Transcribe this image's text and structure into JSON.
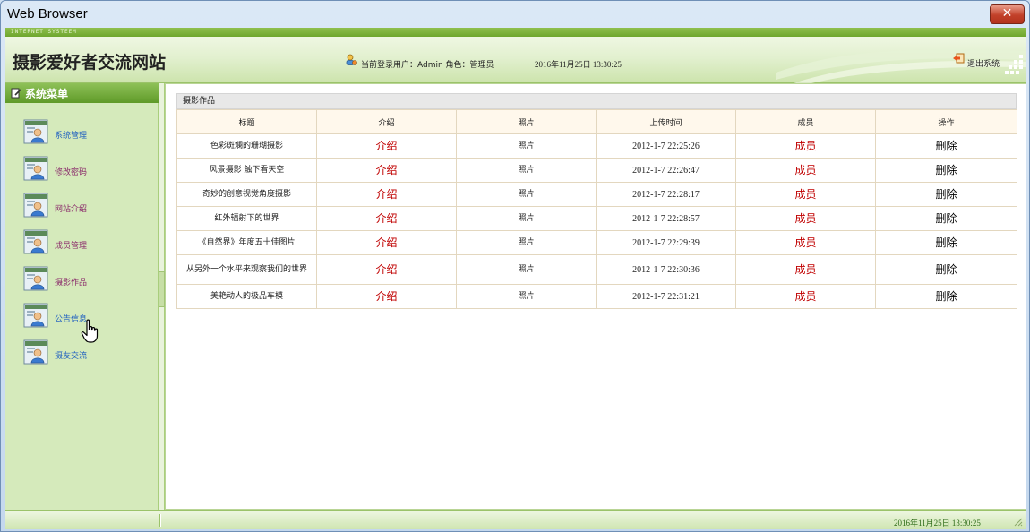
{
  "window": {
    "title": "Web Browser",
    "close_label": "✕"
  },
  "banner": {
    "subtitle": "INTERNET SYSTEEM",
    "site_title": "摄影爱好者交流网站",
    "login_info": "当前登录用户：Admin 角色：管理员",
    "datetime": "2016年11月25日 13:30:25",
    "logout_label": "退出系统"
  },
  "sidebar": {
    "header": "系统菜单",
    "items": [
      {
        "label": "系统管理",
        "color": "#2060c0"
      },
      {
        "label": "修改密码",
        "color": "#8a2a6a"
      },
      {
        "label": "网站介绍",
        "color": "#8a2a6a"
      },
      {
        "label": "成员管理",
        "color": "#8a2a6a"
      },
      {
        "label": "摄影作品",
        "color": "#8a2a6a"
      },
      {
        "label": "公告信息",
        "color": "#2060c0"
      },
      {
        "label": "摄友交流",
        "color": "#2060c0"
      }
    ]
  },
  "panel": {
    "title": "摄影作品",
    "columns": [
      "标题",
      "介绍",
      "照片",
      "上传时间",
      "成员",
      "操作"
    ],
    "rows": [
      {
        "title": "色彩斑斓的珊瑚摄影",
        "intro": "介绍",
        "photo": "照片",
        "time": "2012-1-7 22:25:26",
        "member": "成员",
        "action": "删除"
      },
      {
        "title": "风景摄影 触下看天空",
        "intro": "介绍",
        "photo": "照片",
        "time": "2012-1-7 22:26:47",
        "member": "成员",
        "action": "删除"
      },
      {
        "title": "奇妙的创意视觉角度摄影",
        "intro": "介绍",
        "photo": "照片",
        "time": "2012-1-7 22:28:17",
        "member": "成员",
        "action": "删除"
      },
      {
        "title": "红外辐射下的世界",
        "intro": "介绍",
        "photo": "照片",
        "time": "2012-1-7 22:28:57",
        "member": "成员",
        "action": "删除"
      },
      {
        "title": "《自然界》年度五十佳图片",
        "intro": "介绍",
        "photo": "照片",
        "time": "2012-1-7 22:29:39",
        "member": "成员",
        "action": "删除"
      },
      {
        "title": "从另外一个水平来观察我们的世界",
        "intro": "介绍",
        "photo": "照片",
        "time": "2012-1-7 22:30:36",
        "member": "成员",
        "action": "删除"
      },
      {
        "title": "美艳动人的极品车模",
        "intro": "介绍",
        "photo": "照片",
        "time": "2012-1-7 22:31:21",
        "member": "成员",
        "action": "删除"
      }
    ]
  },
  "statusbar": {
    "datetime": "2016年11月25日 13:30:25"
  },
  "colors": {
    "accent_green": "#6ea62d",
    "link_red": "#c00000"
  },
  "icons": [
    "close-icon",
    "user-icon",
    "logout-icon",
    "menu-edit-icon",
    "menu-user-icon",
    "hand-cursor-icon",
    "resize-grip-icon"
  ]
}
